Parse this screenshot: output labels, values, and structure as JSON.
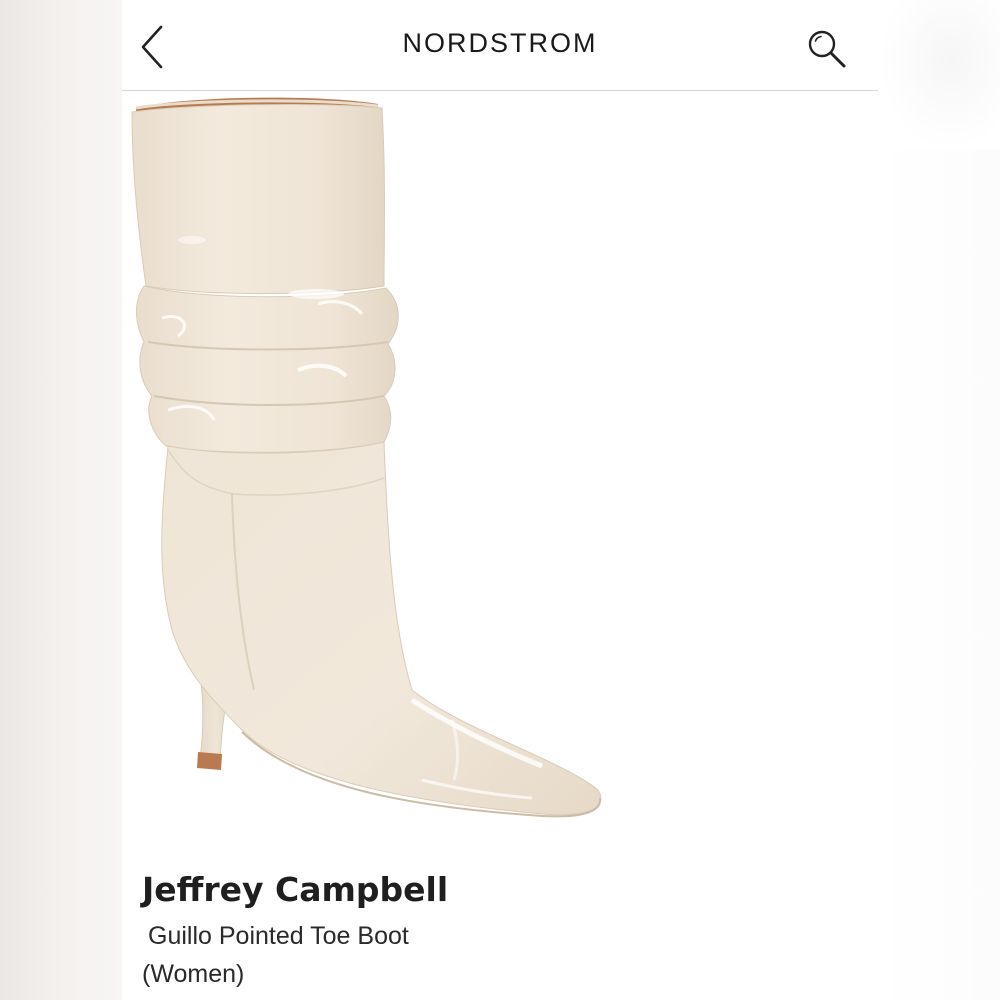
{
  "header": {
    "logo_text": "NORDSTROM",
    "back_icon": "chevron-left-icon",
    "search_icon": "search-icon"
  },
  "product": {
    "brand": "Jeffrey Campbell",
    "name": "Guillo Pointed Toe Boot",
    "audience": "(Women)",
    "image_icon": "product-boot-image",
    "colors": {
      "boot": "#eee3d4",
      "lining": "#b97a52",
      "heel_tip": "#b97a52"
    }
  }
}
